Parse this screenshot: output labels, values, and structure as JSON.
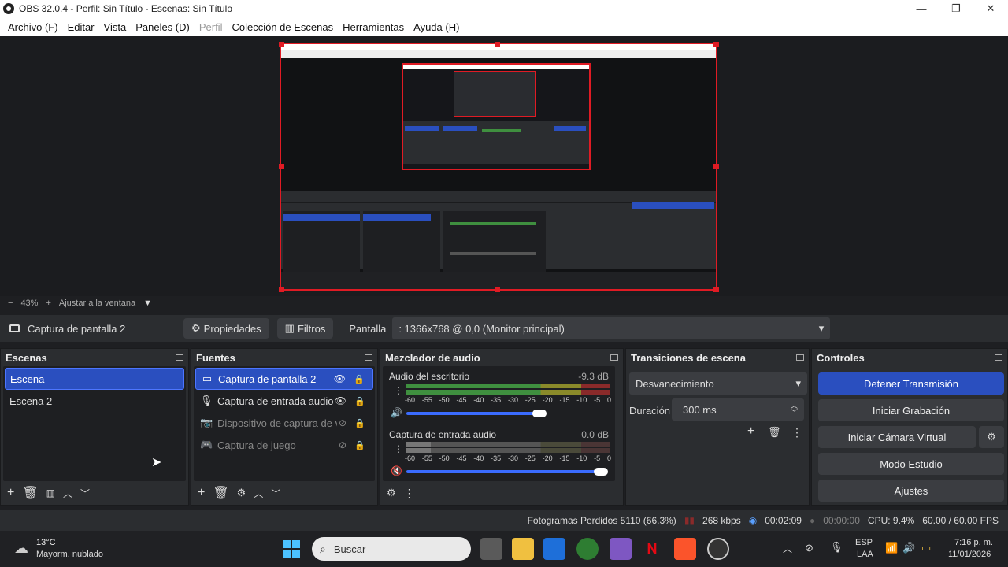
{
  "window": {
    "title": "OBS 32.0.4 - Perfil: Sin Título - Escenas: Sin Título",
    "controls": [
      "—",
      "❐",
      "✕"
    ]
  },
  "menu": [
    {
      "label": "Archivo (F)",
      "enabled": true
    },
    {
      "label": "Editar",
      "enabled": true
    },
    {
      "label": "Vista",
      "enabled": true
    },
    {
      "label": "Paneles (D)",
      "enabled": true
    },
    {
      "label": "Perfil",
      "enabled": false
    },
    {
      "label": "Colección de Escenas",
      "enabled": true
    },
    {
      "label": "Herramientas",
      "enabled": true
    },
    {
      "label": "Ayuda (H)",
      "enabled": true
    }
  ],
  "zoom": {
    "minus": "−",
    "level": "43%",
    "plus": "+",
    "fit_label": "Ajustar a la ventana"
  },
  "source_toolbar": {
    "source_name": "Captura de pantalla 2",
    "properties_label": "Propiedades",
    "filters_label": "Filtros",
    "display_label": "Pantalla",
    "display_value": ": 1366x768 @ 0,0 (Monitor principal)"
  },
  "scenes": {
    "title": "Escenas",
    "items": [
      {
        "label": "Escena",
        "selected": true
      },
      {
        "label": "Escena 2",
        "selected": false
      }
    ]
  },
  "sources": {
    "title": "Fuentes",
    "items": [
      {
        "label": "Captura de pantalla 2",
        "icon": "monitor-icon",
        "visible": true,
        "selected": true
      },
      {
        "label": "Captura de entrada audio",
        "icon": "microphone-icon",
        "visible": true,
        "selected": false
      },
      {
        "label": "Dispositivo de captura de v",
        "icon": "camera-icon",
        "visible": false,
        "selected": false
      },
      {
        "label": "Captura de juego",
        "icon": "gamepad-icon",
        "visible": false,
        "selected": false
      }
    ]
  },
  "mixer": {
    "title": "Mezclador de audio",
    "ticks": [
      "-60",
      "-55",
      "-50",
      "-45",
      "-40",
      "-35",
      "-30",
      "-25",
      "-20",
      "-15",
      "-10",
      "-5",
      "0"
    ],
    "channels": [
      {
        "name": "Audio del escritorio",
        "db": "-9.3 dB",
        "volume": 0.94,
        "muted": false
      },
      {
        "name": "Captura de entrada audio",
        "db": "0.0 dB",
        "volume": 1.0,
        "muted": true
      }
    ]
  },
  "transitions": {
    "title": "Transiciones de escena",
    "selected": "Desvanecimiento",
    "duration_label": "Duración",
    "duration_value": "300 ms"
  },
  "controls": {
    "title": "Controles",
    "stop_stream": "Detener Transmisión",
    "start_recording": "Iniciar Grabación",
    "start_virtual_cam": "Iniciar Cámara Virtual",
    "studio_mode": "Modo Estudio",
    "settings": "Ajustes"
  },
  "status": {
    "dropped_frames": "Fotogramas Perdidos 5110 (66.3%)",
    "bitrate": "268 kbps",
    "stream_time": "00:02:09",
    "record_time": "00:00:00",
    "cpu": "CPU: 9.4%",
    "fps": "60.00 / 60.00 FPS"
  },
  "taskbar": {
    "weather_temp": "13°C",
    "weather_desc": "Mayorm. nublado",
    "search_placeholder": "Buscar",
    "lang1": "ESP",
    "lang2": "LAA",
    "time": "7:16 p. m.",
    "date": "11/01/2026"
  },
  "colors": {
    "accent": "#2a4fbf",
    "recording_outline": "#e01b24",
    "meter_green": "#3f8f3f",
    "meter_yellow": "#8a8a2a",
    "meter_red": "#8a2a2a"
  }
}
